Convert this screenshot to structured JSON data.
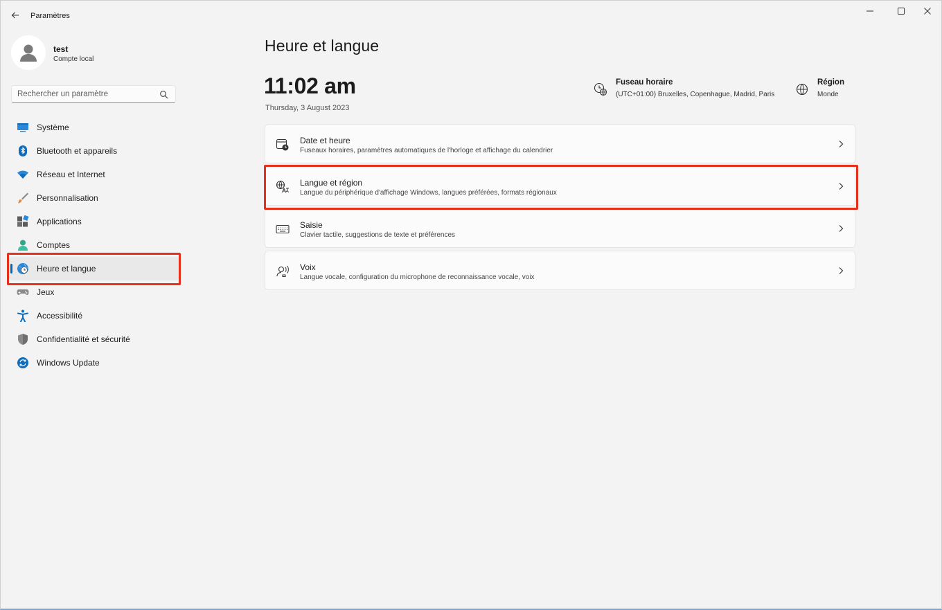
{
  "window": {
    "title": "Paramètres"
  },
  "profile": {
    "name": "test",
    "account_type": "Compte local"
  },
  "search": {
    "placeholder": "Rechercher un paramètre"
  },
  "sidebar": {
    "items": [
      {
        "label": "Système",
        "icon": "system-icon"
      },
      {
        "label": "Bluetooth et appareils",
        "icon": "bluetooth-icon"
      },
      {
        "label": "Réseau et Internet",
        "icon": "wifi-icon"
      },
      {
        "label": "Personnalisation",
        "icon": "brush-icon"
      },
      {
        "label": "Applications",
        "icon": "apps-icon"
      },
      {
        "label": "Comptes",
        "icon": "accounts-icon"
      },
      {
        "label": "Heure et langue",
        "icon": "globe-clock-icon",
        "selected": true
      },
      {
        "label": "Jeux",
        "icon": "gamepad-icon"
      },
      {
        "label": "Accessibilité",
        "icon": "accessibility-icon"
      },
      {
        "label": "Confidentialité et sécurité",
        "icon": "shield-icon"
      },
      {
        "label": "Windows Update",
        "icon": "update-icon"
      }
    ]
  },
  "main": {
    "title": "Heure et langue",
    "time": "11:02 am",
    "date": "Thursday, 3 August 2023",
    "timezone": {
      "title": "Fuseau horaire",
      "value": "(UTC+01:00) Bruxelles, Copenhague, Madrid, Paris"
    },
    "region": {
      "title": "Région",
      "value": "Monde"
    },
    "cards": [
      {
        "title": "Date et heure",
        "subtitle": "Fuseaux horaires, paramètres automatiques de l'horloge et affichage du calendrier",
        "icon": "calendar-clock-icon"
      },
      {
        "title": "Langue et région",
        "subtitle": "Langue du périphérique d'affichage Windows, langues préférées, formats régionaux",
        "icon": "language-icon"
      },
      {
        "title": "Saisie",
        "subtitle": "Clavier tactile, suggestions de texte et préférences",
        "icon": "keyboard-icon"
      },
      {
        "title": "Voix",
        "subtitle": "Langue vocale, configuration du microphone de reconnaissance vocale, voix",
        "icon": "voice-icon"
      }
    ]
  },
  "colors": {
    "accent": "#0067c0",
    "highlight": "#e5301c",
    "background": "#f3f3f3",
    "card": "#fbfbfb"
  }
}
